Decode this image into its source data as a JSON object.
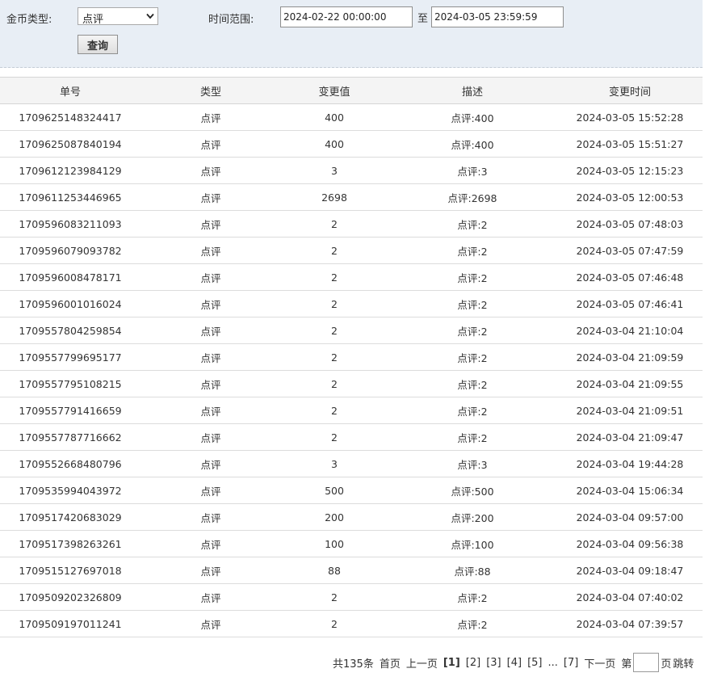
{
  "filter": {
    "coin_type_label": "金币类型:",
    "coin_type_value": "点评",
    "time_range_label": "时间范围:",
    "start_time": "2024-02-22 00:00:00",
    "separator": "至",
    "end_time": "2024-03-05 23:59:59",
    "query_label": "查询"
  },
  "table": {
    "headers": [
      "单号",
      "类型",
      "变更值",
      "描述",
      "变更时间"
    ],
    "rows": [
      [
        "1709625148324417",
        "点评",
        "400",
        "点评:400",
        "2024-03-05 15:52:28"
      ],
      [
        "1709625087840194",
        "点评",
        "400",
        "点评:400",
        "2024-03-05 15:51:27"
      ],
      [
        "1709612123984129",
        "点评",
        "3",
        "点评:3",
        "2024-03-05 12:15:23"
      ],
      [
        "1709611253446965",
        "点评",
        "2698",
        "点评:2698",
        "2024-03-05 12:00:53"
      ],
      [
        "1709596083211093",
        "点评",
        "2",
        "点评:2",
        "2024-03-05 07:48:03"
      ],
      [
        "1709596079093782",
        "点评",
        "2",
        "点评:2",
        "2024-03-05 07:47:59"
      ],
      [
        "1709596008478171",
        "点评",
        "2",
        "点评:2",
        "2024-03-05 07:46:48"
      ],
      [
        "1709596001016024",
        "点评",
        "2",
        "点评:2",
        "2024-03-05 07:46:41"
      ],
      [
        "1709557804259854",
        "点评",
        "2",
        "点评:2",
        "2024-03-04 21:10:04"
      ],
      [
        "1709557799695177",
        "点评",
        "2",
        "点评:2",
        "2024-03-04 21:09:59"
      ],
      [
        "1709557795108215",
        "点评",
        "2",
        "点评:2",
        "2024-03-04 21:09:55"
      ],
      [
        "1709557791416659",
        "点评",
        "2",
        "点评:2",
        "2024-03-04 21:09:51"
      ],
      [
        "1709557787716662",
        "点评",
        "2",
        "点评:2",
        "2024-03-04 21:09:47"
      ],
      [
        "1709552668480796",
        "点评",
        "3",
        "点评:3",
        "2024-03-04 19:44:28"
      ],
      [
        "1709535994043972",
        "点评",
        "500",
        "点评:500",
        "2024-03-04 15:06:34"
      ],
      [
        "1709517420683029",
        "点评",
        "200",
        "点评:200",
        "2024-03-04 09:57:00"
      ],
      [
        "1709517398263261",
        "点评",
        "100",
        "点评:100",
        "2024-03-04 09:56:38"
      ],
      [
        "1709515127697018",
        "点评",
        "88",
        "点评:88",
        "2024-03-04 09:18:47"
      ],
      [
        "1709509202326809",
        "点评",
        "2",
        "点评:2",
        "2024-03-04 07:40:02"
      ],
      [
        "1709509197011241",
        "点评",
        "2",
        "点评:2",
        "2024-03-04 07:39:57"
      ]
    ]
  },
  "pager": {
    "total": "共135条",
    "first": "首页",
    "prev": "上一页",
    "pages": [
      "[1]",
      "[2]",
      "[3]",
      "[4]",
      "[5]"
    ],
    "ellipsis": "...",
    "last_page": "[7]",
    "next": "下一页",
    "jump_prefix": "第",
    "jump_suffix": "页",
    "jump_button": "跳转"
  }
}
